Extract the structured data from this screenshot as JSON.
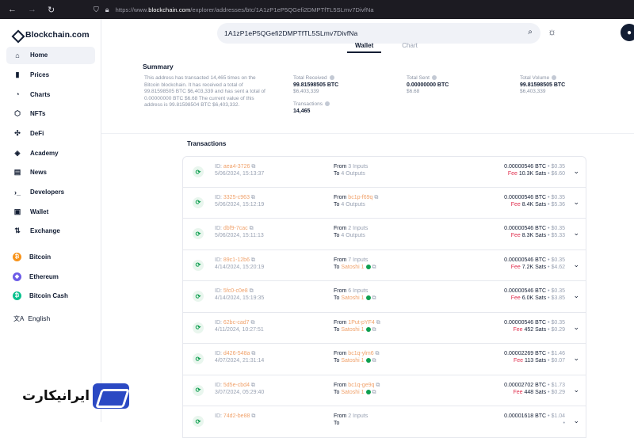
{
  "browser": {
    "url_prefix": "https://www.",
    "url_domain": "blockchain.com",
    "url_path": "/explorer/addresses/btc/1A1zP1eP5QGefi2DMPTfTL5SLmv7DivfNa"
  },
  "brand": {
    "name": "Blockchain.com"
  },
  "sidebar": {
    "items": [
      {
        "label": "Home",
        "icon": "home-icon",
        "glyph": "⌂"
      },
      {
        "label": "Prices",
        "icon": "bars-icon",
        "glyph": "▮"
      },
      {
        "label": "Charts",
        "icon": "pie-icon",
        "glyph": "◔"
      },
      {
        "label": "NFTs",
        "icon": "nft-icon",
        "glyph": "⬡"
      },
      {
        "label": "DeFi",
        "icon": "defi-icon",
        "glyph": "✣"
      },
      {
        "label": "Academy",
        "icon": "academy-icon",
        "glyph": "◈"
      },
      {
        "label": "News",
        "icon": "news-icon",
        "glyph": "▤"
      },
      {
        "label": "Developers",
        "icon": "terminal-icon",
        "glyph": "›_"
      },
      {
        "label": "Wallet",
        "icon": "wallet-icon",
        "glyph": "▣"
      },
      {
        "label": "Exchange",
        "icon": "exchange-icon",
        "glyph": "⇅"
      }
    ],
    "coins": [
      {
        "label": "Bitcoin",
        "color": "#f7931a",
        "glyph": "₿"
      },
      {
        "label": "Ethereum",
        "color": "#6c5ce7",
        "glyph": "◆"
      },
      {
        "label": "Bitcoin Cash",
        "color": "#0ac18e",
        "glyph": "₿"
      }
    ],
    "language": "English"
  },
  "watermark": {
    "text": "ایرانیکارت"
  },
  "search": {
    "value": "1A1zP1eP5QGefi2DMPTfTL5SLmv7DivfNa"
  },
  "tabs": [
    {
      "label": "Wallet"
    },
    {
      "label": "Chart"
    }
  ],
  "summary": {
    "title": "Summary",
    "description": "This address has transacted 14,465 times on the Bitcoin blockchain. It has received a total of 99.81598505 BTC $6,403,339 and has sent a total of 0.00000000 BTC $6.68 The current value of this address is 99.81598504 BTC $6,403,332.",
    "total_received": {
      "label": "Total Received",
      "btc": "99.81598505 BTC",
      "usd": "$6,403,339"
    },
    "total_sent": {
      "label": "Total Sent",
      "btc": "0.00000000 BTC",
      "usd": "$6.68"
    },
    "total_volume": {
      "label": "Total Volume",
      "btc": "99.81598505 BTC",
      "usd": "$6,403,339"
    },
    "transactions": {
      "label": "Transactions",
      "value": "14,465"
    }
  },
  "transactions": {
    "title": "Transactions",
    "rows": [
      {
        "id": "aea4-3726",
        "date": "5/06/2024, 15:13:37",
        "from_label": "From",
        "from": "3 Inputs",
        "to_label": "To",
        "to": "4 Outputs",
        "to_verified": false,
        "btc": "0.00000546 BTC",
        "usd": "$0.35",
        "fee_label": "Fee",
        "fee_sats": "10.3K Sats",
        "fee_usd": "$6.60"
      },
      {
        "id": "3325-c963",
        "date": "5/06/2024, 15:12:19",
        "from_label": "From",
        "from": "bc1p-f69q",
        "to_label": "To",
        "to": "4 Outputs",
        "to_verified": false,
        "btc": "0.00000546 BTC",
        "usd": "$0.35",
        "fee_label": "Fee",
        "fee_sats": "8.4K Sats",
        "fee_usd": "$5.36"
      },
      {
        "id": "dbf9-7cac",
        "date": "5/06/2024, 15:11:13",
        "from_label": "From",
        "from": "2 Inputs",
        "to_label": "To",
        "to": "4 Outputs",
        "to_verified": false,
        "btc": "0.00000546 BTC",
        "usd": "$0.35",
        "fee_label": "Fee",
        "fee_sats": "8.3K Sats",
        "fee_usd": "$5.33"
      },
      {
        "id": "89c1-12b6",
        "date": "4/14/2024, 15:20:19",
        "from_label": "From",
        "from": "7 Inputs",
        "to_label": "To",
        "to": "Satoshi 1",
        "to_verified": true,
        "btc": "0.00000546 BTC",
        "usd": "$0.35",
        "fee_label": "Fee",
        "fee_sats": "7.2K Sats",
        "fee_usd": "$4.62"
      },
      {
        "id": "5fc0-c0e8",
        "date": "4/14/2024, 15:19:35",
        "from_label": "From",
        "from": "6 Inputs",
        "to_label": "To",
        "to": "Satoshi 1",
        "to_verified": true,
        "btc": "0.00000546 BTC",
        "usd": "$0.35",
        "fee_label": "Fee",
        "fee_sats": "6.0K Sats",
        "fee_usd": "$3.85"
      },
      {
        "id": "62bc-cad7",
        "date": "4/11/2024, 10:27:51",
        "from_label": "From",
        "from": "1Put-pYF4",
        "to_label": "To",
        "to": "Satoshi 1",
        "to_verified": true,
        "btc": "0.00000546 BTC",
        "usd": "$0.35",
        "fee_label": "Fee",
        "fee_sats": "452 Sats",
        "fee_usd": "$0.29"
      },
      {
        "id": "d426-548a",
        "date": "4/07/2024, 21:31:14",
        "from_label": "From",
        "from": "bc1q-ylm6",
        "to_label": "To",
        "to": "Satoshi 1",
        "to_verified": true,
        "btc": "0.00002269 BTC",
        "usd": "$1.46",
        "fee_label": "Fee",
        "fee_sats": "113 Sats",
        "fee_usd": "$0.07"
      },
      {
        "id": "5d5e-cbd4",
        "date": "3/07/2024, 05:29:40",
        "from_label": "From",
        "from": "bc1q-ge9q",
        "to_label": "To",
        "to": "Satoshi 1",
        "to_verified": true,
        "btc": "0.00002702 BTC",
        "usd": "$1.73",
        "fee_label": "Fee",
        "fee_sats": "448 Sats",
        "fee_usd": "$0.29"
      },
      {
        "id": "74d2-be88",
        "date": "",
        "from_label": "From",
        "from": "2 Inputs",
        "to_label": "To",
        "to": "",
        "to_verified": false,
        "btc": "0.00001618 BTC",
        "usd": "$1.04",
        "fee_label": "",
        "fee_sats": "",
        "fee_usd": ""
      }
    ]
  }
}
